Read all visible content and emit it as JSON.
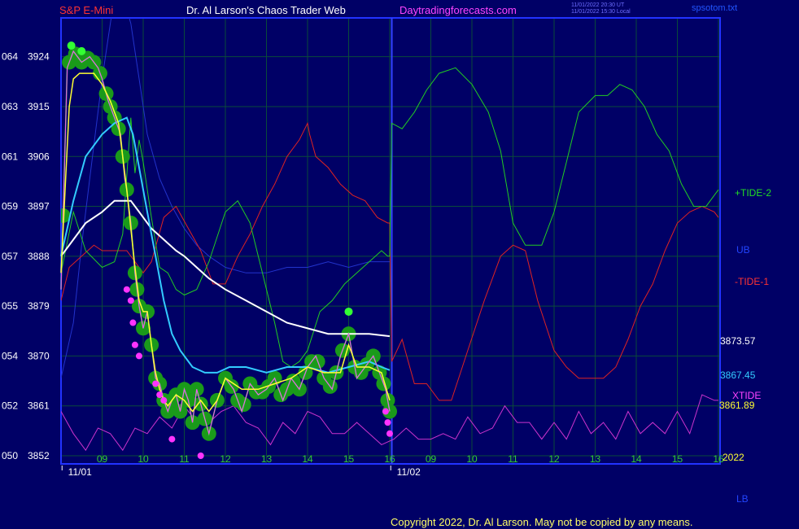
{
  "header": {
    "symbol": "S&P E-Mini",
    "title": "Dr. Al Larson's Chaos Trader Web",
    "site": "Daytradingforecasts.com",
    "timestamp_utc": "11/01/2022 20:30 UT",
    "timestamp_local": "11/01/2022 15:30 Local",
    "filename": "spsotom.txt"
  },
  "copyright": "Copyright 2022, Dr. Al Larson. May not be copied by any means.",
  "colors": {
    "background": "#000066",
    "grid": "#0a4a3a",
    "frame": "#2233ff",
    "price": "#ff44ff",
    "tide_plus": "#22cc22",
    "tide_minus": "#dd2222",
    "xtide": "#cc33cc",
    "ub": "#2233cc",
    "ma_fast": "#ffff33",
    "ma_mid": "#33ccff",
    "ma_slow": "#ffffff",
    "band": "#1a9a1a"
  },
  "right_labels": {
    "tide_plus": "+TIDE-2",
    "ub": "UB",
    "tide_minus": "-TIDE-1",
    "value_slow": "3873.57",
    "value_mid": "3867.45",
    "xtide": "XTIDE",
    "value_fast": "3861.89",
    "year": "2022",
    "lb": "LB"
  },
  "chart_data": {
    "type": "line",
    "ylim": [
      3852,
      3930
    ],
    "xlim": [
      8.0,
      22.0
    ],
    "y_ticks": [
      {
        "left": "050",
        "value": 3852
      },
      {
        "left": "052",
        "value": 3861
      },
      {
        "left": "054",
        "value": 3870
      },
      {
        "left": "055",
        "value": 3879
      },
      {
        "left": "057",
        "value": 3888
      },
      {
        "left": "059",
        "value": 3897
      },
      {
        "left": "061",
        "value": 3906
      },
      {
        "left": "063",
        "value": 3915
      },
      {
        "left": "064",
        "value": 3924
      }
    ],
    "x_ticks": [
      {
        "label": "09",
        "x": 9
      },
      {
        "label": "10",
        "x": 10
      },
      {
        "label": "11",
        "x": 11
      },
      {
        "label": "12",
        "x": 12
      },
      {
        "label": "13",
        "x": 13
      },
      {
        "label": "14",
        "x": 14
      },
      {
        "label": "15",
        "x": 15
      },
      {
        "label": "16",
        "x": 16
      },
      {
        "label": "09",
        "x": 17
      },
      {
        "label": "10",
        "x": 18
      },
      {
        "label": "11",
        "x": 19
      },
      {
        "label": "12",
        "x": 20
      },
      {
        "label": "13",
        "x": 21
      },
      {
        "label": "14",
        "x": 22
      },
      {
        "label": "15",
        "x": 23
      },
      {
        "label": "16",
        "x": 24
      }
    ],
    "date_labels": [
      {
        "label": "11/01",
        "x": 8.5
      },
      {
        "label": "11/02",
        "x": 16.5
      }
    ],
    "series": [
      {
        "key": "price",
        "x": [
          8.0,
          8.15,
          8.3,
          8.5,
          8.7,
          8.9,
          9.0,
          9.15,
          9.3,
          9.45,
          9.55,
          9.6,
          9.7,
          9.8,
          9.9,
          9.95,
          10.0,
          10.1,
          10.2,
          10.3,
          10.4,
          10.5,
          10.6,
          10.7,
          10.8,
          10.9,
          11.0,
          11.1,
          11.2,
          11.3,
          11.45,
          11.6,
          11.8,
          12.0,
          12.2,
          12.4,
          12.6,
          12.8,
          13.0,
          13.2,
          13.4,
          13.6,
          13.8,
          14.0,
          14.2,
          14.4,
          14.6,
          14.8,
          15.0,
          15.2,
          15.4,
          15.6,
          15.8,
          15.9,
          16.0
        ],
        "y": [
          3882,
          3922,
          3925,
          3923,
          3924,
          3922,
          3920,
          3916,
          3913,
          3910,
          3902,
          3900,
          3894,
          3885,
          3879,
          3877,
          3875,
          3878,
          3872,
          3866,
          3865,
          3862,
          3860,
          3862,
          3863,
          3860,
          3864,
          3862,
          3858,
          3864,
          3860,
          3856,
          3862,
          3866,
          3864,
          3860,
          3865,
          3863,
          3864,
          3866,
          3862,
          3866,
          3864,
          3868,
          3870,
          3866,
          3864,
          3870,
          3874,
          3866,
          3868,
          3870,
          3866,
          3864,
          3860
        ]
      },
      {
        "key": "ma_fast",
        "x": [
          8.0,
          8.1,
          8.2,
          8.3,
          8.45,
          8.6,
          8.8,
          9.0,
          9.2,
          9.4,
          9.5,
          9.6,
          9.7,
          9.8,
          9.9,
          10.0,
          10.1,
          10.2,
          10.3,
          10.4,
          10.5,
          10.6,
          10.8,
          11.0,
          11.2,
          11.4,
          11.6,
          11.8,
          12.0,
          12.4,
          12.8,
          13.2,
          13.6,
          14.0,
          14.4,
          14.8,
          15.0,
          15.2,
          15.5,
          15.8,
          16.0
        ],
        "y": [
          3885,
          3900,
          3915,
          3920,
          3921,
          3921,
          3921,
          3919,
          3916,
          3912,
          3906,
          3900,
          3893,
          3886,
          3880,
          3878,
          3878,
          3872,
          3867,
          3864,
          3862,
          3861,
          3863,
          3862,
          3860,
          3862,
          3860,
          3862,
          3866,
          3864,
          3864,
          3865,
          3866,
          3868,
          3867,
          3867,
          3872,
          3868,
          3868,
          3867,
          3862
        ]
      },
      {
        "key": "ma_mid",
        "x": [
          8.0,
          8.3,
          8.6,
          9.0,
          9.3,
          9.6,
          9.75,
          9.9,
          10.1,
          10.3,
          10.5,
          10.7,
          10.9,
          11.2,
          11.5,
          11.8,
          12.1,
          12.5,
          13.0,
          13.5,
          14.0,
          14.5,
          15.0,
          15.5,
          15.8,
          16.0
        ],
        "y": [
          3888,
          3898,
          3906,
          3910,
          3912,
          3913,
          3910,
          3904,
          3896,
          3888,
          3880,
          3874,
          3871,
          3868,
          3867,
          3867,
          3868,
          3868,
          3867,
          3868,
          3868,
          3867,
          3868,
          3869,
          3868,
          3867.45
        ]
      },
      {
        "key": "ma_slow",
        "x": [
          8.0,
          8.3,
          8.6,
          9.0,
          9.3,
          9.5,
          9.7,
          9.9,
          10.2,
          10.5,
          10.8,
          11.0,
          11.3,
          11.6,
          12.0,
          12.5,
          13.0,
          13.5,
          14.0,
          14.5,
          15.0,
          15.5,
          16.0
        ],
        "y": [
          3888,
          3891,
          3894,
          3896,
          3898,
          3898,
          3898,
          3896,
          3893,
          3891,
          3889,
          3888,
          3886,
          3884,
          3882,
          3880,
          3878,
          3876,
          3875,
          3874,
          3874,
          3874,
          3873.57
        ]
      },
      {
        "key": "tide_plus",
        "x": [
          8.0,
          8.3,
          8.6,
          9.0,
          9.3,
          9.5,
          9.7,
          9.8,
          9.9,
          10.0,
          10.2,
          10.4,
          10.6,
          10.8,
          11.0,
          11.3,
          11.6,
          12.0,
          12.3,
          12.6,
          12.9,
          13.2,
          13.4,
          13.6,
          13.8,
          14.0,
          14.3,
          14.6,
          14.9,
          15.2,
          15.5,
          15.8,
          15.95,
          16.0,
          16.05,
          16.3,
          16.6,
          16.9,
          17.2,
          17.6,
          18.0,
          18.4,
          18.7,
          19.0,
          19.3,
          19.7,
          20.0,
          20.3,
          20.6,
          21.0,
          21.3,
          21.6,
          21.9,
          22.2,
          22.5,
          22.8,
          23.1,
          23.4,
          23.7,
          24.0
        ],
        "y": [
          3885,
          3896,
          3889,
          3886,
          3887,
          3892,
          3913,
          3903,
          3909,
          3905,
          3895,
          3886,
          3885,
          3882,
          3881,
          3882,
          3887,
          3896,
          3898,
          3894,
          3885,
          3876,
          3869,
          3868,
          3869,
          3871,
          3878,
          3880,
          3883,
          3885,
          3887,
          3889,
          3888,
          3888,
          3912,
          3911,
          3914,
          3918,
          3921,
          3922,
          3919,
          3914,
          3907,
          3894,
          3890,
          3890,
          3896,
          3905,
          3914,
          3917,
          3917,
          3919,
          3918,
          3915,
          3910,
          3907,
          3901,
          3897,
          3897,
          3900
        ]
      },
      {
        "key": "tide_minus",
        "x": [
          8.0,
          8.2,
          8.5,
          8.8,
          9.0,
          9.2,
          9.4,
          9.6,
          9.8,
          10.0,
          10.2,
          10.5,
          10.8,
          11.1,
          11.4,
          11.7,
          12.0,
          12.3,
          12.6,
          12.9,
          13.2,
          13.5,
          13.8,
          14.0,
          14.05,
          14.2,
          14.5,
          14.8,
          15.1,
          15.4,
          15.7,
          15.95,
          16.0,
          16.05,
          16.3,
          16.6,
          16.9,
          17.2,
          17.5,
          17.9,
          18.3,
          18.7,
          19.0,
          19.3,
          19.6,
          20.0,
          20.3,
          20.6,
          20.9,
          21.2,
          21.5,
          21.8,
          22.1,
          22.4,
          22.7,
          23.0,
          23.3,
          23.6,
          23.9,
          24.0
        ],
        "y": [
          3880,
          3886,
          3888,
          3890,
          3889,
          3889,
          3889,
          3889,
          3887,
          3885,
          3887,
          3895,
          3897,
          3893,
          3889,
          3883,
          3883,
          3888,
          3892,
          3897,
          3901,
          3906,
          3909,
          3912,
          3910,
          3906,
          3904,
          3901,
          3899,
          3898,
          3895,
          3894,
          3894,
          3869,
          3873,
          3865,
          3865,
          3862,
          3862,
          3871,
          3880,
          3888,
          3890,
          3889,
          3880,
          3871,
          3868,
          3866,
          3866,
          3866,
          3868,
          3873,
          3879,
          3883,
          3889,
          3894,
          3896,
          3897,
          3896,
          3895
        ]
      },
      {
        "key": "xtide",
        "x": [
          8.0,
          8.3,
          8.6,
          8.9,
          9.2,
          9.5,
          9.8,
          10.1,
          10.4,
          10.7,
          11.0,
          11.3,
          11.6,
          11.9,
          12.2,
          12.5,
          12.8,
          13.1,
          13.4,
          13.7,
          14.0,
          14.3,
          14.6,
          14.9,
          15.2,
          15.5,
          15.8,
          16.1,
          16.4,
          16.7,
          17.0,
          17.3,
          17.6,
          17.9,
          18.2,
          18.5,
          18.8,
          19.1,
          19.4,
          19.7,
          20.0,
          20.3,
          20.6,
          20.9,
          21.2,
          21.5,
          21.8,
          22.1,
          22.4,
          22.7,
          23.0,
          23.3,
          23.6,
          23.9,
          24.0
        ],
        "y": [
          3860,
          3856,
          3853,
          3857,
          3856,
          3853,
          3857,
          3856,
          3859,
          3857,
          3861,
          3858,
          3858,
          3860,
          3861,
          3858,
          3857,
          3854,
          3858,
          3856,
          3860,
          3859,
          3856,
          3856,
          3858,
          3856,
          3854,
          3855,
          3857,
          3855,
          3855,
          3856,
          3855,
          3859,
          3856,
          3857,
          3861,
          3858,
          3858,
          3855,
          3858,
          3855,
          3860,
          3856,
          3858,
          3855,
          3860,
          3856,
          3858,
          3856,
          3860,
          3856,
          3863,
          3862,
          3862
        ]
      },
      {
        "key": "ub",
        "x": [
          8.0,
          8.3,
          8.5,
          8.7,
          9.0,
          9.3,
          9.5,
          9.7,
          9.9,
          10.1,
          10.4,
          10.7,
          11.0,
          11.3,
          11.6,
          12.0,
          12.5,
          13.0,
          13.5,
          14.0,
          14.5,
          15.0,
          15.5,
          16.0
        ],
        "y": [
          3866,
          3876,
          3890,
          3902,
          3920,
          3935,
          3935,
          3930,
          3920,
          3910,
          3902,
          3897,
          3893,
          3890,
          3888,
          3886,
          3885,
          3885,
          3886,
          3886,
          3887,
          3886,
          3887,
          3887
        ]
      }
    ],
    "band_markers_x": [
      8.05,
      8.2,
      8.35,
      8.5,
      8.65,
      8.8,
      8.95,
      9.1,
      9.2,
      9.3,
      9.4,
      9.5,
      9.6,
      9.7,
      9.8,
      9.85,
      9.9,
      10.0,
      10.1,
      10.2,
      10.3,
      10.4,
      10.5,
      10.6,
      10.7,
      10.8,
      10.9,
      11.0,
      11.1,
      11.2,
      11.3,
      11.4,
      11.5,
      11.6,
      11.8,
      12.0,
      12.15,
      12.3,
      12.45,
      12.6,
      12.75,
      12.9,
      13.05,
      13.2,
      13.35,
      13.5,
      13.65,
      13.8,
      13.95,
      14.1,
      14.25,
      14.4,
      14.55,
      14.7,
      14.85,
      15.0,
      15.15,
      15.3,
      15.45,
      15.6,
      15.75,
      15.85,
      15.95,
      16.0
    ],
    "magenta_dots": [
      {
        "x": 9.6,
        "y": 3882
      },
      {
        "x": 9.7,
        "y": 3880
      },
      {
        "x": 9.75,
        "y": 3876
      },
      {
        "x": 9.8,
        "y": 3872
      },
      {
        "x": 9.9,
        "y": 3870
      },
      {
        "x": 10.3,
        "y": 3865
      },
      {
        "x": 10.4,
        "y": 3863
      },
      {
        "x": 10.5,
        "y": 3862
      },
      {
        "x": 10.7,
        "y": 3855
      },
      {
        "x": 11.4,
        "y": 3852
      },
      {
        "x": 15.9,
        "y": 3860
      },
      {
        "x": 16.0,
        "y": 3856
      },
      {
        "x": 15.95,
        "y": 3858
      }
    ]
  }
}
